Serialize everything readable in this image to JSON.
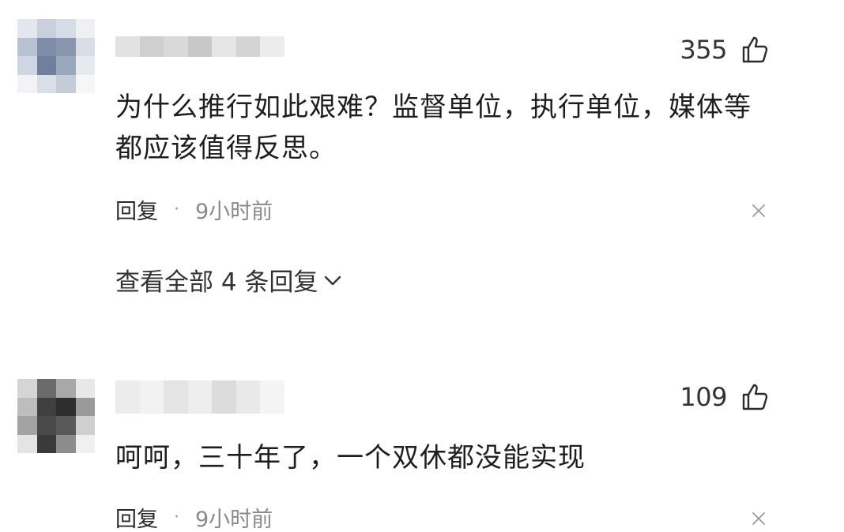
{
  "comments": [
    {
      "likes": "355",
      "text_lines": [
        "为什么推行如此艰难？监督单位，执行单位，媒体等",
        "都应该值得反思。"
      ],
      "reply_label": "回复",
      "separator": "·",
      "time": "9小时前",
      "view_all_replies": "查看全部 4 条回复"
    },
    {
      "likes": "109",
      "text_lines": [
        "呵呵，三十年了，一个双休都没能实现"
      ],
      "reply_label": "回复",
      "separator": "·",
      "time": "9小时前"
    }
  ],
  "icons": {
    "like": "thumbs-up-icon",
    "close": "close-icon",
    "expand": "chevron-down-icon"
  },
  "colors": {
    "text": "#1e1e1e",
    "meta": "#8a8a8a",
    "background": "#ffffff"
  }
}
